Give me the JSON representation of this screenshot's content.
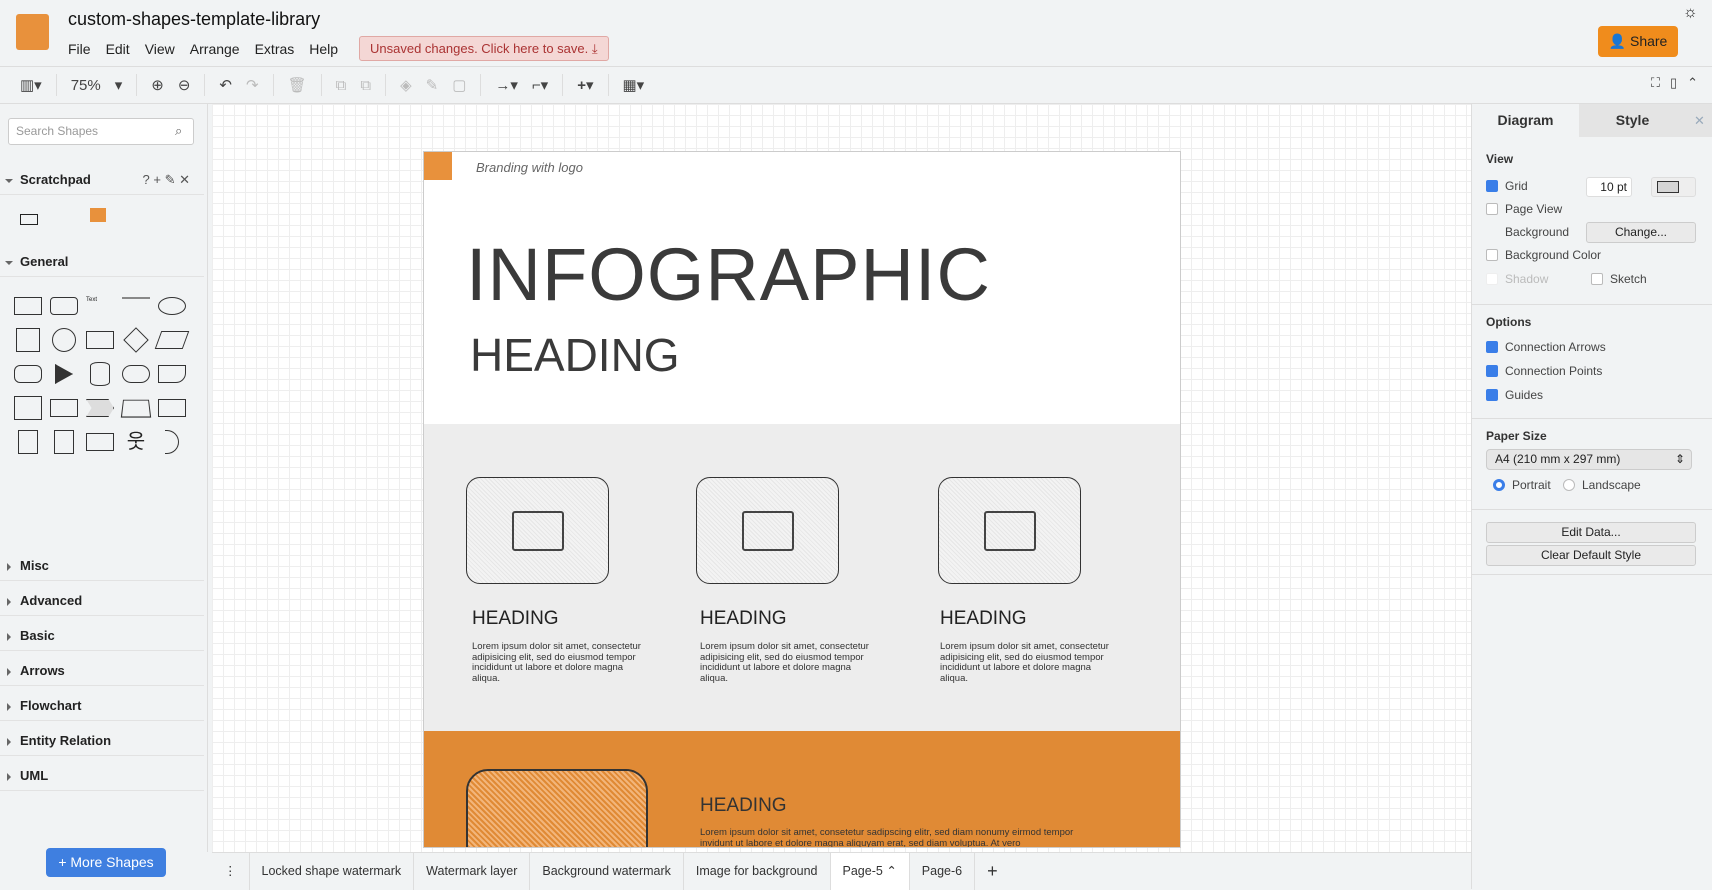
{
  "app": {
    "title": "custom-shapes-template-library",
    "menu": [
      "File",
      "Edit",
      "View",
      "Arrange",
      "Extras",
      "Help"
    ],
    "unsaved": "Unsaved changes. Click here to save.",
    "share": "Share"
  },
  "toolbar": {
    "zoom": "75%"
  },
  "sidebar": {
    "search_placeholder": "Search Shapes",
    "scratchpad": "Scratchpad",
    "scratch_icons": "? + ✎ ✕",
    "general": "General",
    "sections": [
      "Misc",
      "Advanced",
      "Basic",
      "Arrows",
      "Flowchart",
      "Entity Relation",
      "UML"
    ],
    "more_shapes": "+ More Shapes"
  },
  "page": {
    "branding": "Branding with logo",
    "title": "INFOGRAPHIC",
    "subtitle": "HEADING",
    "columns": [
      {
        "heading": "HEADING",
        "text": "Lorem ipsum dolor sit amet, consectetur adipisicing elit, sed do eiusmod tempor incididunt ut labore et dolore magna aliqua."
      },
      {
        "heading": "HEADING",
        "text": "Lorem ipsum dolor sit amet, consectetur adipisicing elit, sed do eiusmod tempor incididunt ut labore et dolore magna aliqua."
      },
      {
        "heading": "HEADING",
        "text": "Lorem ipsum dolor sit amet, consectetur adipisicing elit, sed do eiusmod tempor incididunt ut labore et dolore magna aliqua."
      }
    ],
    "orange_heading": "HEADING",
    "orange_text": "Lorem ipsum dolor sit amet, consetetur sadipscing elitr, sed diam nonumy eirmod tempor invidunt ut labore et dolore magna aliquyam erat, sed diam voluptua. At vero"
  },
  "panel": {
    "tab_diagram": "Diagram",
    "tab_style": "Style",
    "view": "View",
    "grid": "Grid",
    "grid_size": "10 pt",
    "page_view": "Page View",
    "background": "Background",
    "change": "Change...",
    "background_color": "Background Color",
    "shadow": "Shadow",
    "sketch": "Sketch",
    "options": "Options",
    "connection_arrows": "Connection Arrows",
    "connection_points": "Connection Points",
    "guides": "Guides",
    "paper_size": "Paper Size",
    "paper": "A4 (210 mm x 297 mm)",
    "portrait": "Portrait",
    "landscape": "Landscape",
    "edit_data": "Edit Data...",
    "clear_style": "Clear Default Style"
  },
  "tabs": [
    "Locked shape watermark",
    "Watermark layer",
    "Background watermark",
    "Image for background",
    "Page-5",
    "Page-6"
  ]
}
